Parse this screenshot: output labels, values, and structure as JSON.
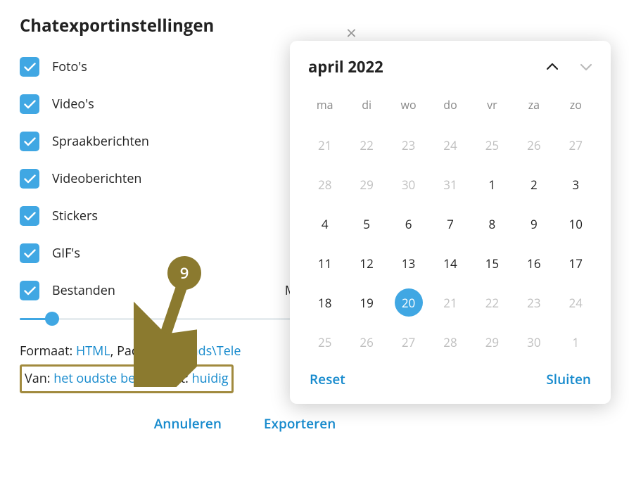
{
  "settings": {
    "title": "Chatexportinstellingen",
    "items": [
      {
        "label": "Foto's",
        "checked": true
      },
      {
        "label": "Video's",
        "checked": true
      },
      {
        "label": "Spraakberichten",
        "checked": true
      },
      {
        "label": "Videoberichten",
        "checked": true
      },
      {
        "label": "Stickers",
        "checked": true
      },
      {
        "label": "GIF's",
        "checked": true
      },
      {
        "label": "Bestanden",
        "checked": true,
        "right": "Maximale gr"
      }
    ],
    "format_label": "Formaat: ",
    "format_value": "HTML",
    "path_label": ", Pad: ",
    "path_value": "Downloads\\Tele",
    "range_from_label": "Van: ",
    "range_from_value": "het oudste bericht",
    "range_sep": ", tot: ",
    "range_to_value": "huidig",
    "cancel": "Annuleren",
    "export": "Exporteren"
  },
  "calendar": {
    "title": "april 2022",
    "dow": [
      "ma",
      "di",
      "wo",
      "do",
      "vr",
      "za",
      "zo"
    ],
    "days": [
      {
        "n": 21,
        "out": true
      },
      {
        "n": 22,
        "out": true
      },
      {
        "n": 23,
        "out": true
      },
      {
        "n": 24,
        "out": true
      },
      {
        "n": 25,
        "out": true
      },
      {
        "n": 26,
        "out": true
      },
      {
        "n": 27,
        "out": true
      },
      {
        "n": 28,
        "out": true
      },
      {
        "n": 29,
        "out": true
      },
      {
        "n": 30,
        "out": true
      },
      {
        "n": 31,
        "out": true
      },
      {
        "n": 1
      },
      {
        "n": 2
      },
      {
        "n": 3
      },
      {
        "n": 4
      },
      {
        "n": 5
      },
      {
        "n": 6
      },
      {
        "n": 7
      },
      {
        "n": 8
      },
      {
        "n": 9
      },
      {
        "n": 10
      },
      {
        "n": 11
      },
      {
        "n": 12
      },
      {
        "n": 13
      },
      {
        "n": 14
      },
      {
        "n": 15
      },
      {
        "n": 16
      },
      {
        "n": 17
      },
      {
        "n": 18
      },
      {
        "n": 19
      },
      {
        "n": 20,
        "selected": true
      },
      {
        "n": 21,
        "out": true
      },
      {
        "n": 22,
        "out": true
      },
      {
        "n": 23,
        "out": true
      },
      {
        "n": 24,
        "out": true
      },
      {
        "n": 25,
        "out": true
      },
      {
        "n": 26,
        "out": true
      },
      {
        "n": 27,
        "out": true
      },
      {
        "n": 28,
        "out": true
      },
      {
        "n": 29,
        "out": true
      },
      {
        "n": 30,
        "out": true
      },
      {
        "n": 1,
        "out": true
      }
    ],
    "reset": "Reset",
    "close": "Sluiten"
  },
  "annotation": {
    "badge": "9"
  },
  "colors": {
    "accent": "#40a7e3",
    "link": "#168acd",
    "highlight": "#a18a3e",
    "badge": "#8b7a2f"
  }
}
